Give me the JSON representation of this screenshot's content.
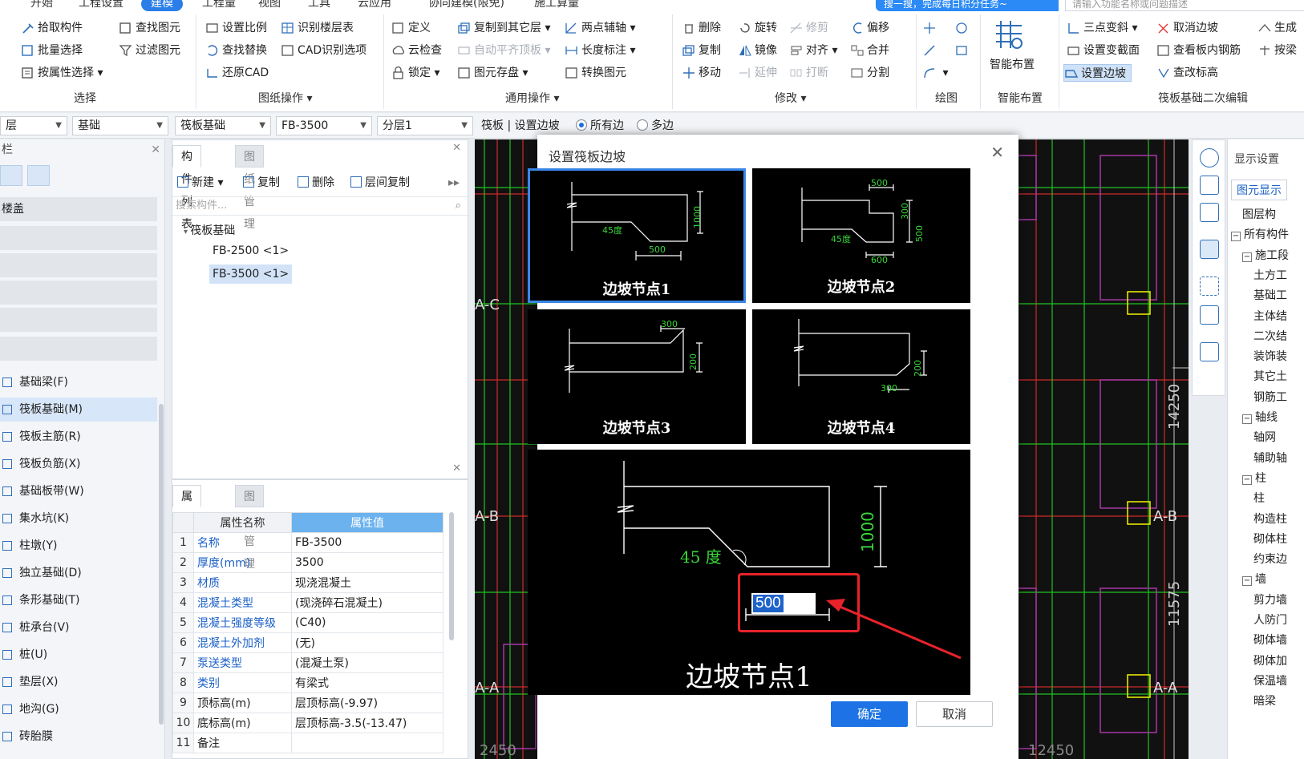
{
  "menu": {
    "tabs": [
      "开始",
      "工程设置",
      "建模",
      "工程量",
      "视图",
      "工具",
      "云应用",
      "协同建模(限免)",
      "施工算量"
    ],
    "active_tab": "建模",
    "promo": "搜一搜，完成每日积分任务~",
    "search_placeholder": "请输入功能名称或问题描述"
  },
  "ribbon": {
    "select": {
      "items": [
        "拾取构件",
        "批量选择",
        "按属性选择",
        "查找图元",
        "过滤图元"
      ],
      "label": "选择"
    },
    "drawing_ops": {
      "items": [
        "设置比例",
        "识别楼层表",
        "查找替换",
        "CAD识别选项",
        "还原CAD"
      ],
      "label": "图纸操作"
    },
    "common_ops": {
      "items": [
        "定义",
        "复制到其它层",
        "两点辅轴",
        "云检查",
        "自动平齐顶板",
        "长度标注",
        "锁定",
        "图元存盘",
        "转换图元"
      ],
      "label": "通用操作"
    },
    "modify": {
      "items": [
        "删除",
        "旋转",
        "修剪",
        "偏移",
        "复制",
        "镜像",
        "对齐",
        "合并",
        "移动",
        "延伸",
        "打断",
        "分割"
      ],
      "label": "修改"
    },
    "draw": {
      "label": "绘图"
    },
    "smart": {
      "item": "智能布置",
      "label": "智能布置"
    },
    "raft_edit": {
      "items": [
        "三点变斜",
        "取消边坡",
        "生成",
        "设置变截面",
        "查看板内钢筋",
        "按梁",
        "设置边坡",
        "查改标高"
      ],
      "label": "筏板基础二次编辑"
    }
  },
  "selector_bar": {
    "floor": "层",
    "category": "基础",
    "type": "筏板基础",
    "component": "FB-3500",
    "layer": "分层1",
    "breadcrumb": "筏板 | 设置边坡",
    "radio_all": "所有边",
    "radio_multi": "多边"
  },
  "left_nav": {
    "header": "栏",
    "category": "楼盖",
    "items": [
      "基础梁(F)",
      "筏板基础(M)",
      "筏板主筋(R)",
      "筏板负筋(X)",
      "基础板带(W)",
      "集水坑(K)",
      "柱墩(Y)",
      "独立基础(D)",
      "条形基础(T)",
      "桩承台(V)",
      "桩(U)",
      "垫层(X)",
      "地沟(G)",
      "砖胎膜"
    ],
    "selected": "筏板基础(M)"
  },
  "component_list": {
    "tabs": [
      "构件列表",
      "图纸管理"
    ],
    "buttons": [
      "新建",
      "复制",
      "删除",
      "层间复制"
    ],
    "search_placeholder": "搜索构件...",
    "tree_root": "筏板基础",
    "leaves": [
      "FB-2500 <1>",
      "FB-3500 <1>"
    ],
    "selected_leaf": "FB-3500 <1>"
  },
  "property_list": {
    "tabs": [
      "属性列表",
      "图层管理"
    ],
    "col_name": "属性名称",
    "col_value": "属性值",
    "rows": [
      {
        "n": "1",
        "name": "名称",
        "value": "FB-3500"
      },
      {
        "n": "2",
        "name": "厚度(mm)",
        "value": "3500"
      },
      {
        "n": "3",
        "name": "材质",
        "value": "现浇混凝土"
      },
      {
        "n": "4",
        "name": "混凝土类型",
        "value": "(现浇碎石混凝土)"
      },
      {
        "n": "5",
        "name": "混凝土强度等级",
        "value": "(C40)"
      },
      {
        "n": "6",
        "name": "混凝土外加剂",
        "value": "(无)"
      },
      {
        "n": "7",
        "name": "泵送类型",
        "value": "(混凝土泵)"
      },
      {
        "n": "8",
        "name": "类别",
        "value": "有梁式"
      },
      {
        "n": "9",
        "name": "顶标高(m)",
        "value": "层顶标高(-9.97)"
      },
      {
        "n": "10",
        "name": "底标高(m)",
        "value": "层顶标高-3.5(-13.47)"
      },
      {
        "n": "11",
        "name": "备注",
        "value": ""
      }
    ]
  },
  "canvas": {
    "axis_labels": [
      "A-C",
      "A-B",
      "A-A"
    ],
    "right_axis_labels": [
      "A-B",
      "A-A"
    ],
    "dims_bottom": [
      "2450",
      "12450"
    ],
    "dims_right": [
      "14250",
      "11575"
    ]
  },
  "display_panel": {
    "title": "显示设置",
    "tab": "图元显示",
    "items": [
      "图层构",
      "所有构件",
      "施工段",
      "土方工",
      "基础工",
      "主体结",
      "二次结",
      "装饰装",
      "其它土",
      "钢筋工",
      "轴线",
      "轴网",
      "辅助轴",
      "柱",
      "柱",
      "构造柱",
      "砌体柱",
      "约束边",
      "墙",
      "剪力墙",
      "人防门",
      "砌体墙",
      "砌体加",
      "保温墙",
      "暗梁"
    ]
  },
  "dialog": {
    "title": "设置筏板边坡",
    "nodes": [
      {
        "caption": "边坡节点1",
        "labels": [
          "45度",
          "500",
          "1000"
        ]
      },
      {
        "caption": "边坡节点2",
        "labels": [
          "500",
          "300",
          "45度",
          "500",
          "600"
        ]
      },
      {
        "caption": "边坡节点3",
        "labels": [
          "300",
          "200"
        ]
      },
      {
        "caption": "边坡节点4",
        "labels": [
          "200",
          "300"
        ]
      }
    ],
    "detail": {
      "caption": "边坡节点1",
      "angle_label": "45 度",
      "height_label": "1000",
      "width_value": "500"
    },
    "ok": "确定",
    "cancel": "取消",
    "colors": {
      "accent": "#1d73e6",
      "highlight": "#e8232a",
      "dim_green": "#39d63a"
    }
  }
}
